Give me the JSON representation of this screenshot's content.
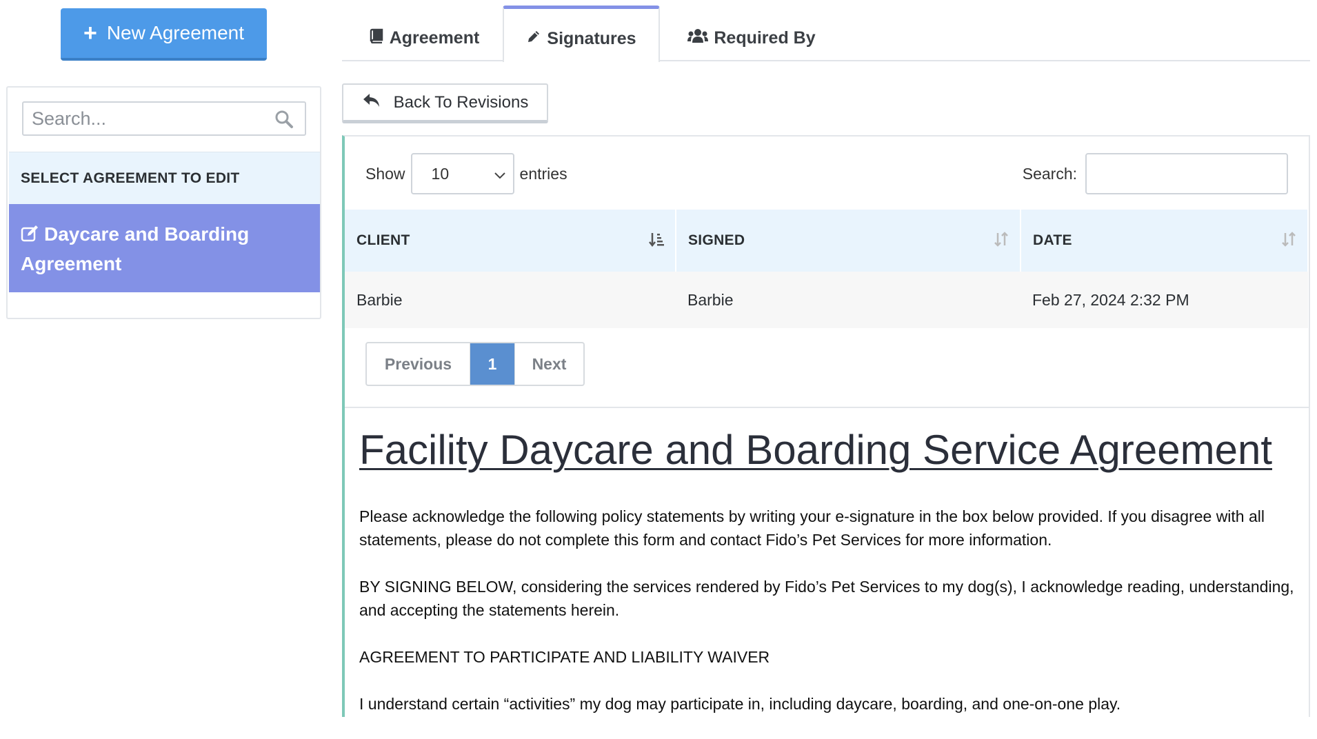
{
  "sidebar": {
    "new_button_label": "New Agreement",
    "search_placeholder": "Search...",
    "section_title": "SELECT AGREEMENT TO EDIT",
    "selected_item_label": "Daycare and Boarding Agreement"
  },
  "tabs": [
    {
      "label": "Agreement",
      "icon": "book-icon"
    },
    {
      "label": "Signatures",
      "icon": "pencil-icon",
      "active": true
    },
    {
      "label": "Required By",
      "icon": "users-icon"
    }
  ],
  "back_button_label": "Back To Revisions",
  "table_controls": {
    "show_label": "Show",
    "entries_value": "10",
    "entries_label": "entries",
    "search_label": "Search:",
    "search_value": ""
  },
  "table": {
    "columns": [
      "CLIENT",
      "SIGNED",
      "DATE"
    ],
    "rows": [
      {
        "client": "Barbie",
        "signed": "Barbie",
        "date": "Feb 27, 2024 2:32 PM"
      }
    ]
  },
  "pagination": {
    "previous_label": "Previous",
    "current_page": "1",
    "next_label": "Next"
  },
  "document": {
    "title": "Facility Daycare and Boarding Service Agreement",
    "paragraphs": [
      "Please acknowledge the following policy statements by writing your e-signature in the box below provided. If you disagree with all statements, please do not complete this form and contact Fido’s Pet Services for more information.",
      "BY SIGNING BELOW, considering the services rendered by Fido’s Pet Services to my dog(s), I acknowledge reading, understanding, and accepting the statements herein.",
      "AGREEMENT TO PARTICIPATE AND LIABILITY WAIVER",
      "I understand certain “activities” my dog may participate in, including daycare, boarding, and one-on-one play."
    ]
  },
  "colors": {
    "primary_button": "#4d9ae8",
    "selected_item": "#8391e6",
    "table_header_bg": "#e9f4fd",
    "active_page": "#5a8fd0",
    "panel_accent": "#7ec8b8"
  }
}
